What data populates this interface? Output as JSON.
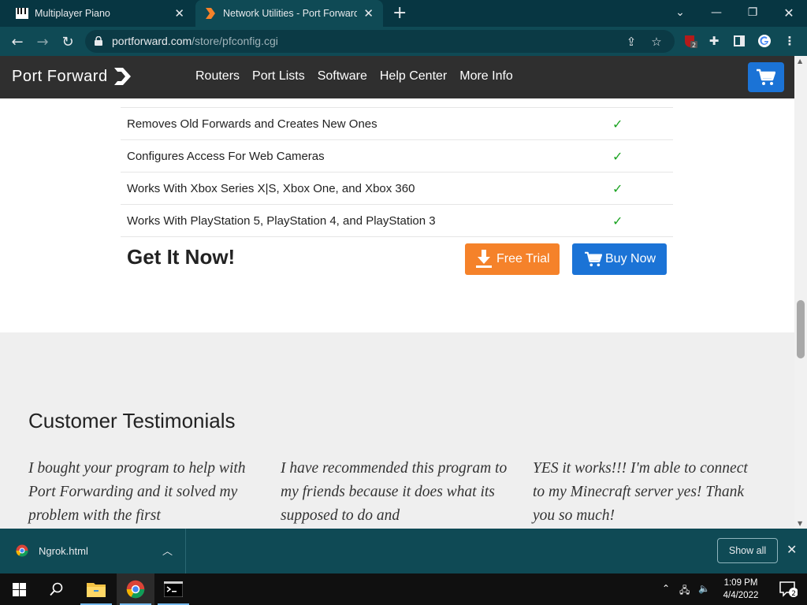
{
  "browser": {
    "tabs": [
      {
        "title": "Multiplayer Piano",
        "icon": "piano-icon",
        "active": false
      },
      {
        "title": "Network Utilities - Port Forwarding",
        "icon": "portforward-icon",
        "active": true
      }
    ],
    "url_host": "portforward.com",
    "url_path": "/store/pfconfig.cgi",
    "extension_badge": "2"
  },
  "site": {
    "logo_text": "Port Forward",
    "nav": [
      "Routers",
      "Port Lists",
      "Software",
      "Help Center",
      "More Info"
    ]
  },
  "features": [
    {
      "text": "Removes Old Forwards and Creates New Ones",
      "check": "✓"
    },
    {
      "text": "Configures Access For Web Cameras",
      "check": "✓"
    },
    {
      "text": "Works With Xbox Series X|S, Xbox One, and Xbox 360",
      "check": "✓"
    },
    {
      "text": "Works With PlayStation 5, PlayStation 4, and PlayStation 3",
      "check": "✓"
    }
  ],
  "cta": {
    "title": "Get It Now!",
    "free_trial": "Free Trial",
    "buy_now": "Buy Now"
  },
  "testimonials": {
    "title": "Customer Testimonials",
    "quotes": [
      "I bought your program to help with Port Forwarding and it solved my problem with the first",
      "I have recommended this program to my friends because it does what its supposed to do and",
      "YES it works!!! I'm able to connect to my Minecraft server yes! Thank you so much!"
    ]
  },
  "downloads": {
    "file": "Ngrok.html",
    "show_all": "Show all"
  },
  "taskbar": {
    "time": "1:09 PM",
    "date": "4/4/2022",
    "notifications": "2"
  },
  "colors": {
    "accent_orange": "#f5822a",
    "accent_blue": "#1b73d6",
    "check_green": "#1aa321",
    "chrome_dark": "#073642"
  }
}
